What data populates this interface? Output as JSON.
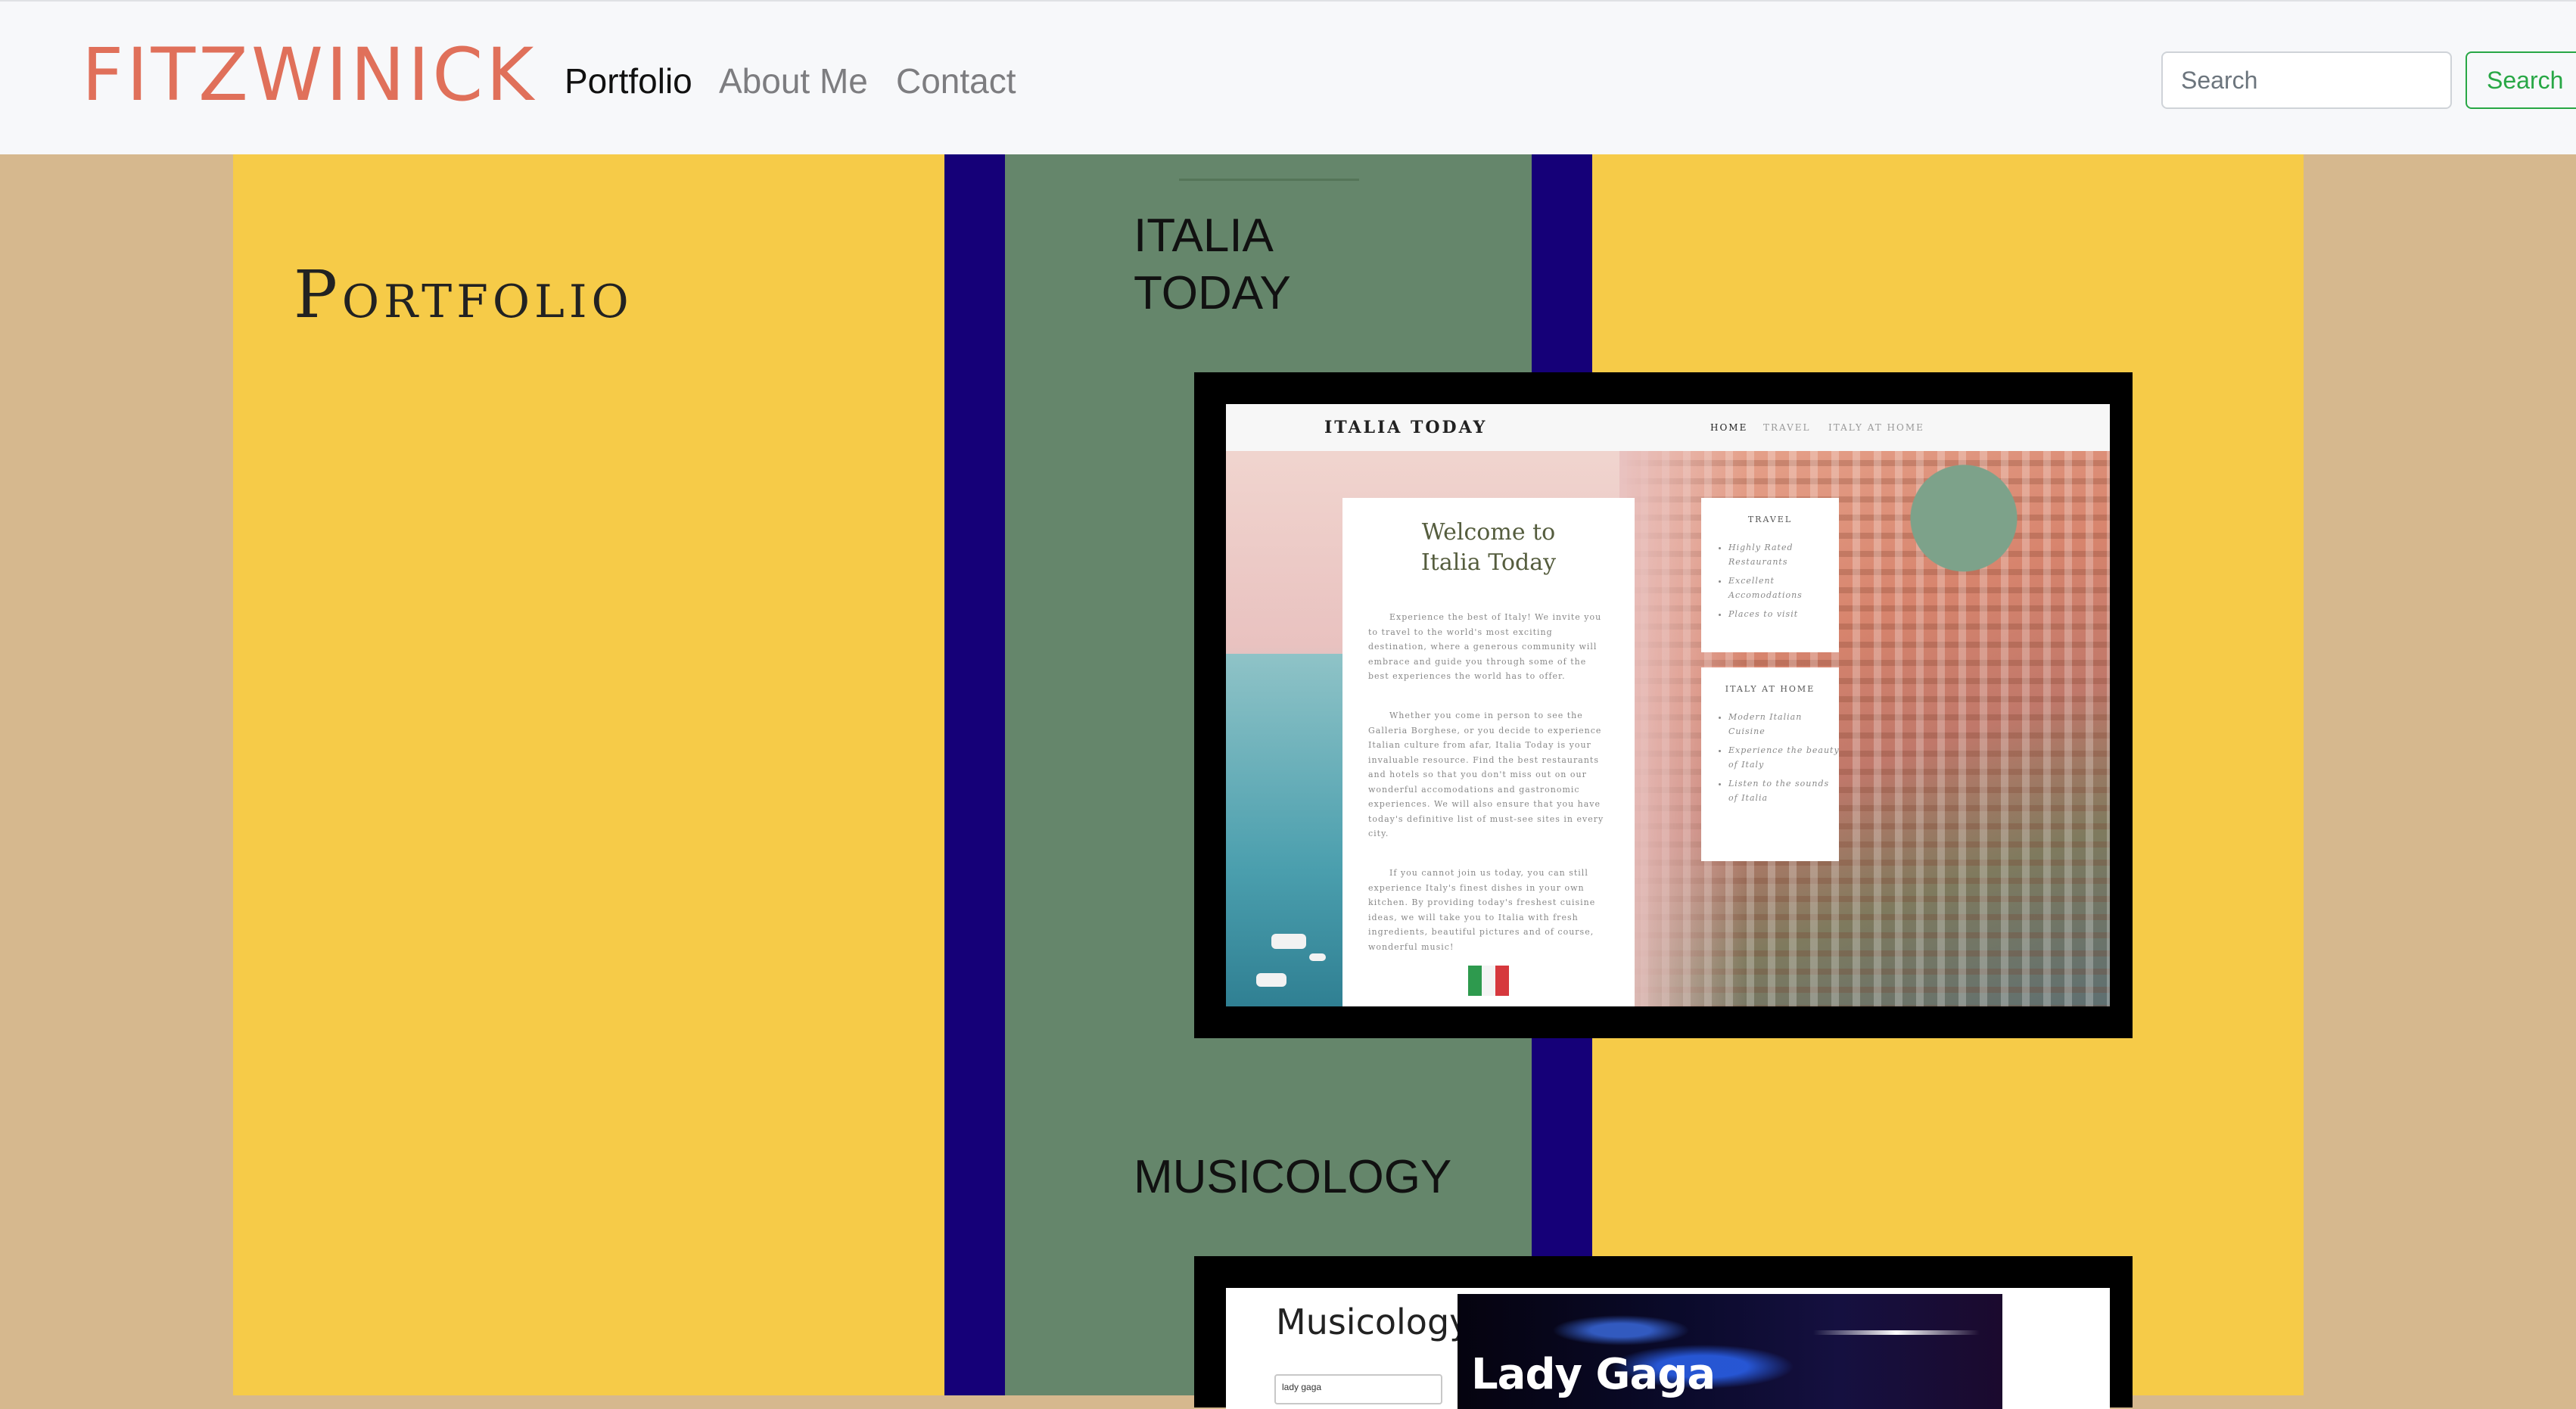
{
  "navbar": {
    "brand": "FITZWINICK",
    "links": [
      {
        "label": "Portfolio",
        "active": true
      },
      {
        "label": "About Me",
        "active": false
      },
      {
        "label": "Contact",
        "active": false
      }
    ],
    "search": {
      "placeholder": "Search",
      "button_label": "Search"
    }
  },
  "colors": {
    "background": "#d6b88e",
    "yellow": "#f6cb48",
    "navy": "#150078",
    "green": "#65866b",
    "brand": "#e0705a",
    "search_button": "#28a745"
  },
  "main": {
    "page_title": "Portfolio",
    "projects": [
      {
        "title_line1": "ITALIA",
        "title_line2": "TODAY",
        "screenshot": {
          "brand": "ITALIA TODAY",
          "nav": [
            "HOME",
            "TRAVEL",
            "ITALY AT HOME"
          ],
          "welcome_title_line1": "Welcome to",
          "welcome_title_line2": "Italia Today",
          "paragraphs": [
            "Experience the best of Italy! We invite you to travel to the world's most exciting destination, where a generous community will embrace and guide you through some of the best experiences the world has to offer.",
            "Whether you come in person to see the Galleria Borghese, or you decide to experience Italian culture from afar, Italia Today is your invaluable resource. Find the best restaurants and hotels so that you don't miss out on our wonderful accomodations and gastronomic experiences. We will also ensure that you have today's definitive list of must-see sites in every city.",
            "If you cannot join us today, you can still experience Italy's finest dishes in your own kitchen. By providing today's freshest cuisine ideas, we will take you to Italia with fresh ingredients, beautiful pictures and of course, wonderful music!"
          ],
          "travel": {
            "heading": "TRAVEL",
            "items": [
              "Highly Rated Restaurants",
              "Excellent Accomodations",
              "Places to visit"
            ]
          },
          "italy_at_home": {
            "heading": "ITALY AT HOME",
            "items": [
              "Modern Italian Cuisine",
              "Experience the beauty of Italy",
              "Listen to the sounds of Italia"
            ]
          }
        }
      },
      {
        "title": "MUSICOLOGY",
        "screenshot": {
          "logo": "Musicology",
          "search_value": "lady gaga",
          "banner_text": "Lady Gaga"
        }
      }
    ]
  }
}
